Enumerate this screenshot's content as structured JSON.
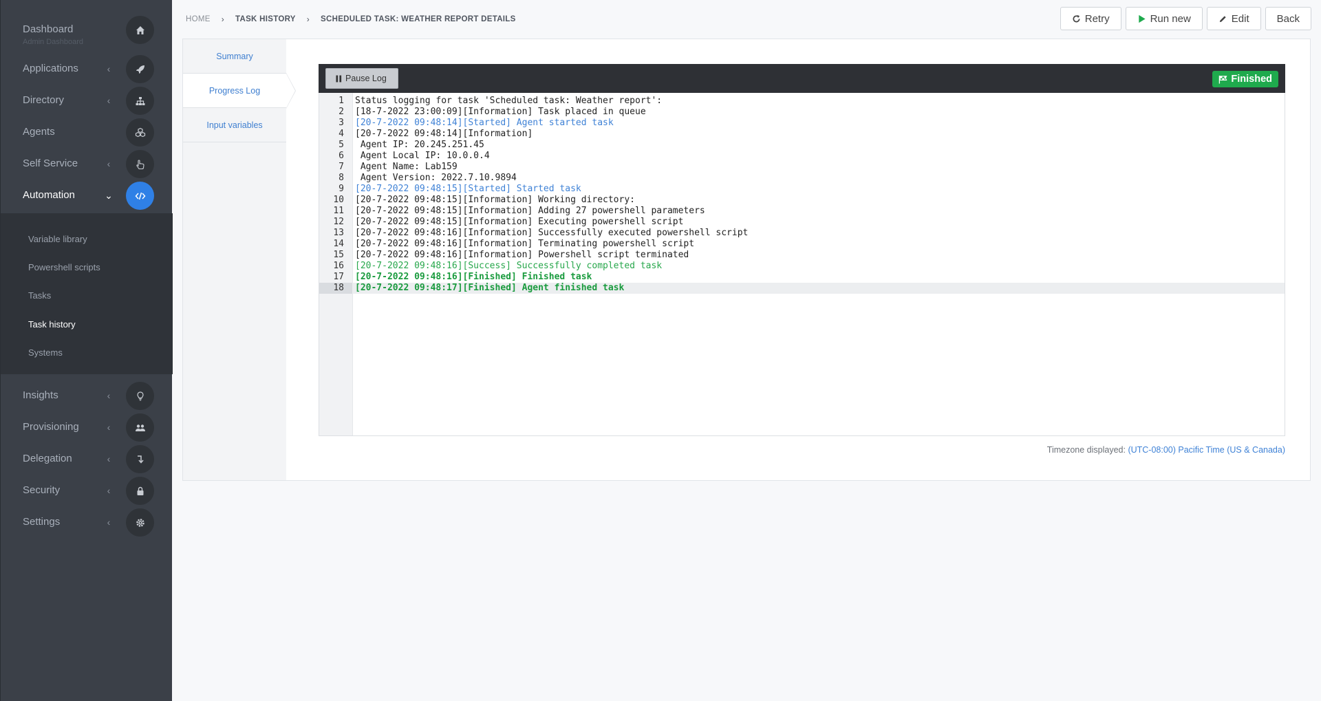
{
  "sidebar": {
    "items": [
      {
        "label": "Dashboard",
        "sub": "Admin Dashboard",
        "icon": "home-icon",
        "chevron": false
      },
      {
        "label": "Applications",
        "icon": "rocket-icon",
        "chevron": true
      },
      {
        "label": "Directory",
        "icon": "sitemap-icon",
        "chevron": true
      },
      {
        "label": "Agents",
        "icon": "cubes-icon",
        "chevron": false
      },
      {
        "label": "Self Service",
        "icon": "hand-pointer-icon",
        "chevron": true
      },
      {
        "label": "Automation",
        "icon": "code-icon",
        "chevron": true,
        "active": true
      },
      {
        "label": "Insights",
        "icon": "lightbulb-icon",
        "chevron": true
      },
      {
        "label": "Provisioning",
        "icon": "users-icon",
        "chevron": true
      },
      {
        "label": "Delegation",
        "icon": "level-down-icon",
        "chevron": true
      },
      {
        "label": "Security",
        "icon": "lock-icon",
        "chevron": true
      },
      {
        "label": "Settings",
        "icon": "gear-icon",
        "chevron": true
      }
    ],
    "automation_sub": [
      "Variable library",
      "Powershell scripts",
      "Tasks",
      "Task history",
      "Systems"
    ],
    "active_sub": "Task history"
  },
  "breadcrumb": [
    "HOME",
    "TASK HISTORY",
    "SCHEDULED TASK: WEATHER REPORT DETAILS"
  ],
  "buttons": {
    "retry": "Retry",
    "run_new": "Run new",
    "edit": "Edit",
    "back": "Back"
  },
  "tabs": [
    "Summary",
    "Progress Log",
    "Input variables"
  ],
  "active_tab": "Progress Log",
  "log": {
    "pause_label": "Pause Log",
    "status_label": "Finished",
    "lines": [
      {
        "n": "1",
        "text": "Status logging for task 'Scheduled task: Weather report':",
        "type": "info"
      },
      {
        "n": "2",
        "text": "[18-7-2022 23:00:09][Information] Task placed in queue",
        "type": "info"
      },
      {
        "n": "3",
        "text": "[20-7-2022 09:48:14][Started] Agent started task",
        "type": "started"
      },
      {
        "n": "4",
        "text": "[20-7-2022 09:48:14][Information]",
        "type": "info"
      },
      {
        "n": "5",
        "text": " Agent IP: 20.245.251.45",
        "type": "info"
      },
      {
        "n": "6",
        "text": " Agent Local IP: 10.0.0.4",
        "type": "info"
      },
      {
        "n": "7",
        "text": " Agent Name: Lab159",
        "type": "info"
      },
      {
        "n": "8",
        "text": " Agent Version: 2022.7.10.9894",
        "type": "info"
      },
      {
        "n": "9",
        "text": "[20-7-2022 09:48:15][Started] Started task",
        "type": "started"
      },
      {
        "n": "10",
        "text": "[20-7-2022 09:48:15][Information] Working directory:",
        "type": "info"
      },
      {
        "n": "11",
        "text": "[20-7-2022 09:48:15][Information] Adding 27 powershell parameters",
        "type": "info"
      },
      {
        "n": "12",
        "text": "[20-7-2022 09:48:15][Information] Executing powershell script",
        "type": "info"
      },
      {
        "n": "13",
        "text": "[20-7-2022 09:48:16][Information] Successfully executed powershell script",
        "type": "info"
      },
      {
        "n": "14",
        "text": "[20-7-2022 09:48:16][Information] Terminating powershell script",
        "type": "info"
      },
      {
        "n": "15",
        "text": "[20-7-2022 09:48:16][Information] Powershell script terminated",
        "type": "info"
      },
      {
        "n": "16",
        "text": "[20-7-2022 09:48:16][Success] Successfully completed task",
        "type": "success"
      },
      {
        "n": "17",
        "text": "[20-7-2022 09:48:16][Finished] Finished task",
        "type": "finished"
      },
      {
        "n": "18",
        "text": "[20-7-2022 09:48:17][Finished] Agent finished task",
        "type": "finished",
        "current": true
      }
    ]
  },
  "timezone": {
    "label": "Timezone displayed:",
    "value": "(UTC-08:00) Pacific Time (US & Canada)"
  },
  "colors": {
    "accent": "#2f80e6",
    "success": "#1faa4d",
    "sidebar_bg": "#3b4048"
  }
}
